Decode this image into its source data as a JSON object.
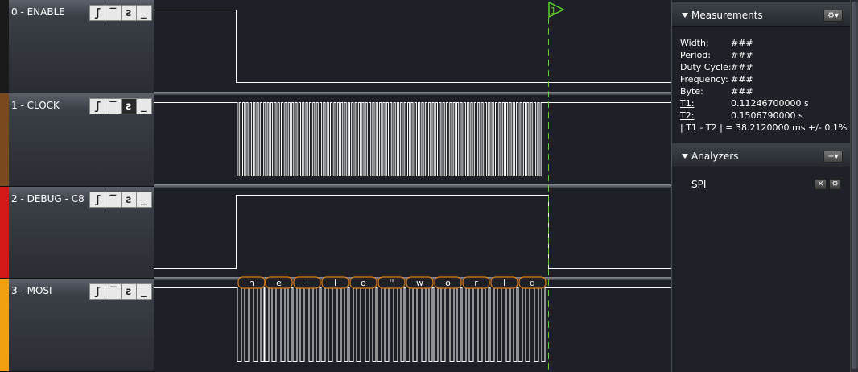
{
  "channels": [
    {
      "name": "0 - ENABLE",
      "color": "#1a1a1a",
      "triggers": [
        "rising-edge-icon",
        "high-level-icon",
        "falling-edge-icon",
        "low-level-icon"
      ],
      "active_trigger": -1
    },
    {
      "name": "1 - CLOCK",
      "color": "#7a4a1e",
      "triggers": [
        "rising-edge-icon",
        "high-level-icon",
        "falling-edge-icon",
        "low-level-icon"
      ],
      "active_trigger": 2
    },
    {
      "name": "2 - DEBUG - C8",
      "color": "#d21818",
      "triggers": [
        "rising-edge-icon",
        "high-level-icon",
        "falling-edge-icon",
        "low-level-icon"
      ],
      "active_trigger": -1
    },
    {
      "name": "3 - MOSI",
      "color": "#f0a010",
      "triggers": [
        "rising-edge-icon",
        "high-level-icon",
        "falling-edge-icon",
        "low-level-icon"
      ],
      "active_trigger": -1
    }
  ],
  "marker": {
    "label": "1",
    "color": "#5fd02a"
  },
  "decoded_bytes": [
    "h",
    "e",
    "l",
    "l",
    "o",
    "' '",
    "w",
    "o",
    "r",
    "l",
    "d"
  ],
  "measurements": {
    "title": "Measurements",
    "rows": [
      {
        "label": "Width:",
        "value": "###",
        "underline": false
      },
      {
        "label": "Period:",
        "value": "###",
        "underline": false
      },
      {
        "label": "Duty Cycle:",
        "value": "###",
        "underline": false
      },
      {
        "label": "Frequency:",
        "value": "###",
        "underline": false
      },
      {
        "label": "Byte:",
        "value": "###",
        "underline": false
      },
      {
        "label": "T1:",
        "value": "0.11246700000 s",
        "underline": true
      },
      {
        "label": "T2:",
        "value": "0.1506790000 s",
        "underline": true
      }
    ],
    "delta": "| T1 - T2 | = 38.2120000 ms +/- 0.1%",
    "settings_icon": "gear-icon"
  },
  "analyzers": {
    "title": "Analyzers",
    "add_icon": "plus-icon",
    "items": [
      {
        "name": "SPI",
        "remove_icon": "close-icon",
        "settings_icon": "gear-icon"
      }
    ]
  },
  "colors": {
    "background": "#1d2127",
    "waveform": "#ffffff",
    "decode": "#e07b10",
    "marker": "#5fd02a"
  }
}
